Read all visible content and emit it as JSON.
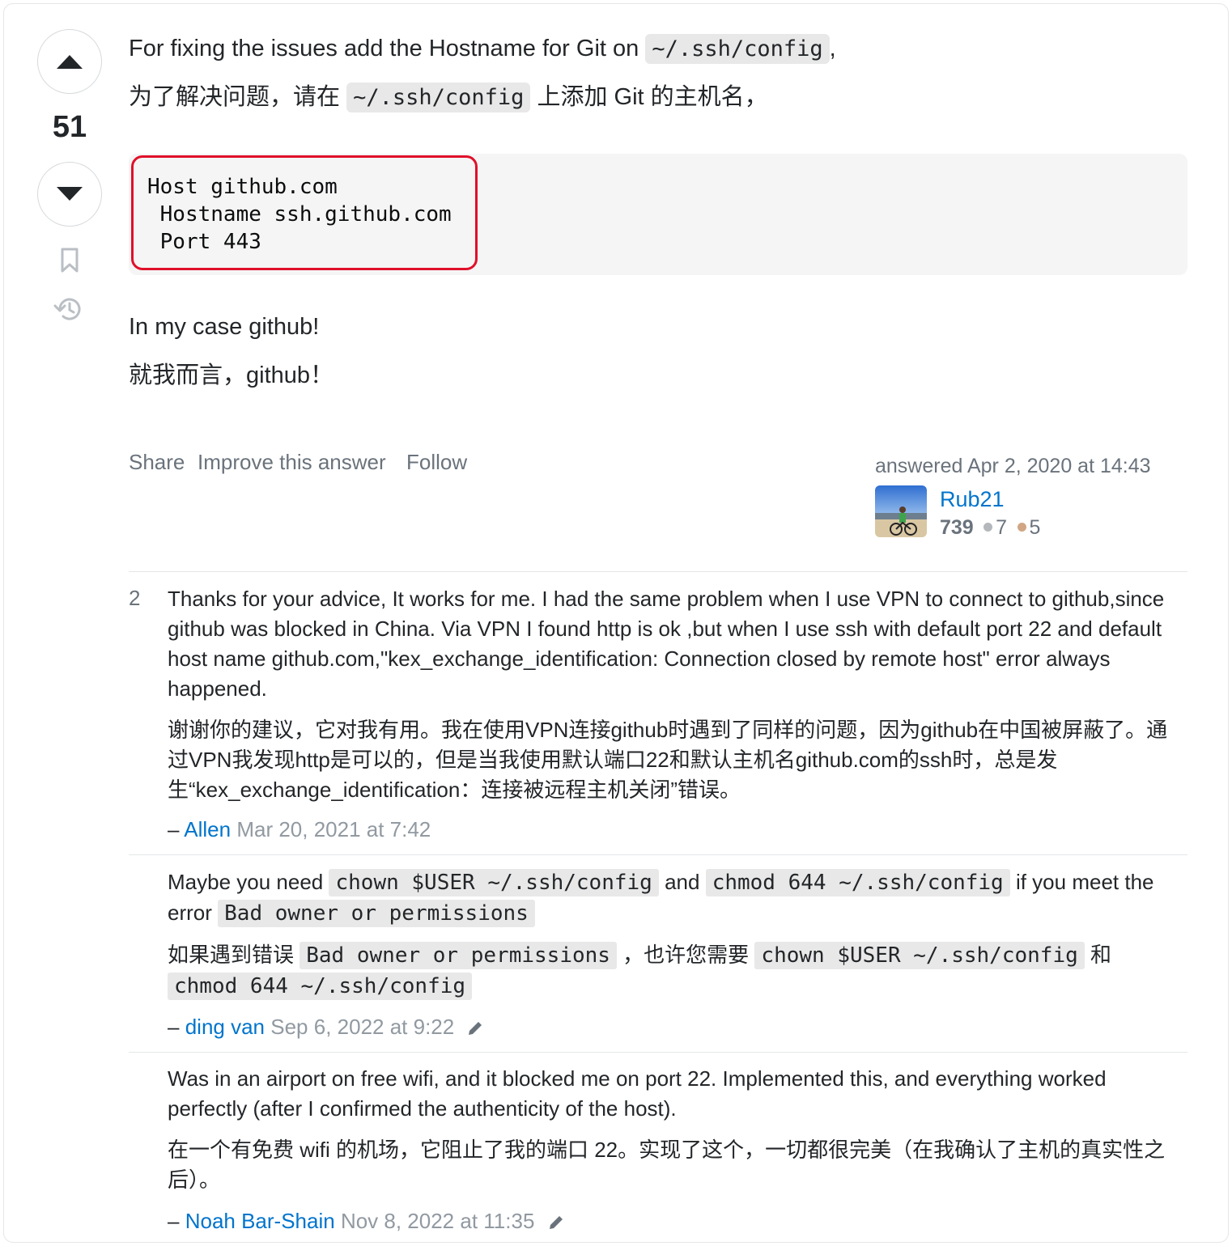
{
  "vote": {
    "count": "51"
  },
  "answer": {
    "para1": {
      "before": "For fixing the issues add the Hostname for Git on",
      "code": "~/.ssh/config",
      "after": ","
    },
    "para2": {
      "before": "为了解决问题，请在",
      "code": "~/.ssh/config",
      "after": "上添加 Git 的主机名，"
    },
    "code_block": {
      "lines": [
        "Host github.com",
        " Hostname ssh.github.com",
        " Port 443"
      ]
    },
    "para3": "In my case github!",
    "para4": "就我而言，github！"
  },
  "post_menu": {
    "share": "Share",
    "improve": "Improve this answer",
    "follow": "Follow"
  },
  "author": {
    "answered": "answered Apr 2, 2020 at 14:43",
    "name": "Rub21",
    "reputation": "739",
    "silver_badges": "7",
    "bronze_badges": "5",
    "silver_color": "#b4b8bc",
    "bronze_color": "#d1a684"
  },
  "comments": [
    {
      "score": "2",
      "text_en": "Thanks for your advice, It works for me. I had the same problem when I use VPN to connect to github,since github was blocked in China. Via VPN I found http is ok ,but when I use ssh with default port 22 and default host name github.com,\"kex_exchange_identification: Connection closed by remote host\" error always happened.",
      "text_zh": "谢谢你的建议，它对我有用。我在使用VPN连接github时遇到了同样的问题，因为github在中国被屏蔽了。通过VPN我发现http是可以的，但是当我使用默认端口22和默认主机名github.com的ssh时，总是发生“kex_exchange_identification：连接被远程主机关闭”错误。",
      "dash": "–",
      "user": "Allen",
      "date": "Mar 20, 2021 at 7:42"
    },
    {
      "en": {
        "t1": "Maybe you need",
        "c1": "chown $USER ~/.ssh/config",
        "t2": "and",
        "c2": "chmod 644 ~/.ssh/config",
        "t3": "if you meet the error",
        "c3": "Bad owner or permissions"
      },
      "zh": {
        "t1": "如果遇到错误",
        "c1": "Bad owner or permissions",
        "t2": "，也许您需要",
        "c2": "chown $USER ~/.ssh/config",
        "t3": "和",
        "c3": "chmod 644 ~/.ssh/config"
      },
      "dash": "–",
      "user": "ding van",
      "date": "Sep 6, 2022 at 9:22"
    },
    {
      "text_en": "Was in an airport on free wifi, and it blocked me on port 22. Implemented this, and everything worked perfectly (after I confirmed the authenticity of the host).",
      "text_zh": "在一个有免费 wifi 的机场，它阻止了我的端口 22。实现了这个，一切都很完美（在我确认了主机的真实性之后）。",
      "dash": "–",
      "user": "Noah Bar-Shain",
      "date": "Nov 8, 2022 at 11:35"
    }
  ],
  "icons": {
    "upvote": "arrow-up-icon",
    "downvote": "arrow-down-icon",
    "bookmark": "bookmark-icon",
    "history": "history-icon",
    "edit": "pencil-icon"
  }
}
